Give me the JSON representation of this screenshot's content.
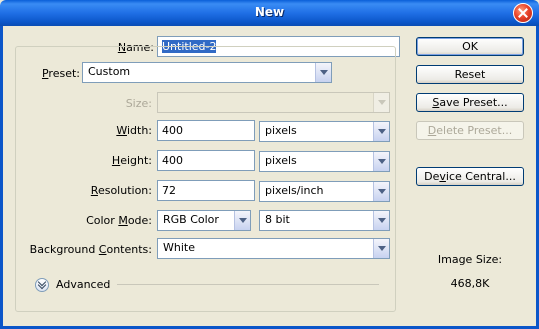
{
  "window": {
    "title": "New"
  },
  "name": {
    "label": "Name:",
    "label_u": "N",
    "label_rest": "ame:",
    "value": "Untitled-2"
  },
  "preset": {
    "label_u": "P",
    "label_rest": "reset:",
    "value": "Custom"
  },
  "size": {
    "label": "Size:",
    "value": ""
  },
  "width": {
    "label_u": "W",
    "label_rest": "idth:",
    "value": "400",
    "unit": "pixels"
  },
  "height": {
    "label_u": "H",
    "label_rest": "eight:",
    "value": "400",
    "unit": "pixels"
  },
  "resolution": {
    "label_u": "R",
    "label_rest": "esolution:",
    "value": "72",
    "unit": "pixels/inch"
  },
  "color_mode": {
    "label_pre": "Color ",
    "label_u": "M",
    "label_rest": "ode:",
    "mode": "RGB Color",
    "depth": "8 bit"
  },
  "background": {
    "label_pre": "Background ",
    "label_u": "C",
    "label_rest": "ontents:",
    "value": "White"
  },
  "advanced": {
    "label": "Advanced"
  },
  "buttons": {
    "ok": "OK",
    "reset": "Reset",
    "save_preset_u": "S",
    "save_preset_rest": "ave Preset...",
    "delete_preset_u": "D",
    "delete_preset_rest": "elete Preset...",
    "device_central_u": "v",
    "device_central_pre": "De",
    "device_central_rest": "ice Central..."
  },
  "image_size": {
    "label": "Image Size:",
    "value": "468,8K"
  },
  "colors": {
    "title_bar": "#0b56c9",
    "dialog_bg": "#ece9d8",
    "selection": "#316ac5"
  }
}
